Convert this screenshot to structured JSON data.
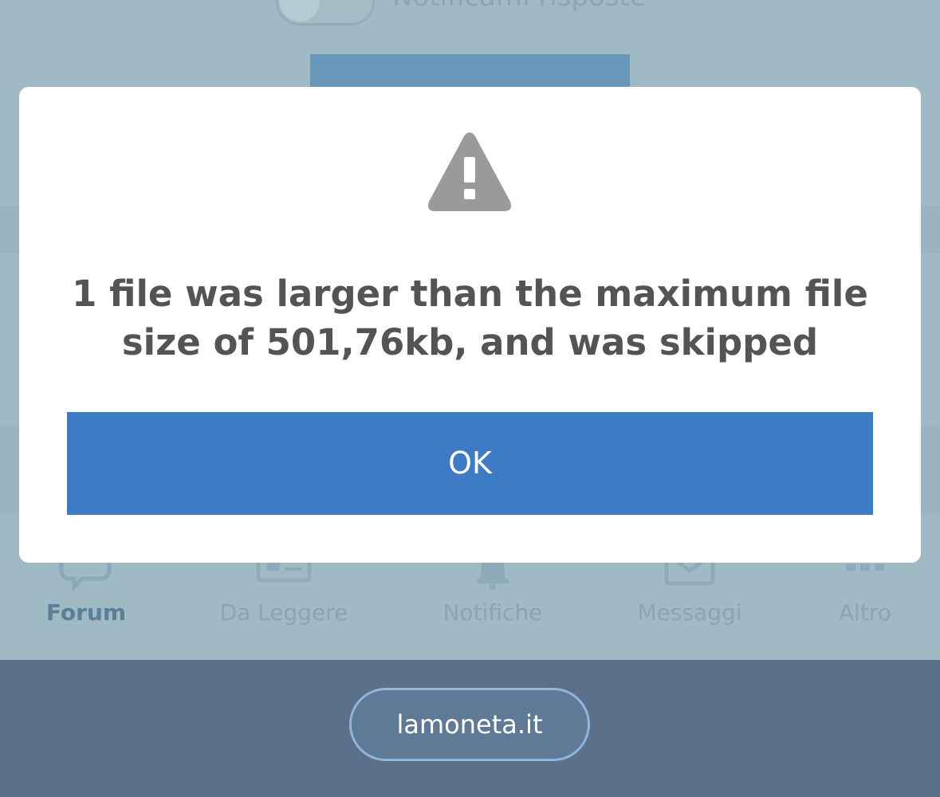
{
  "background_page": {
    "notify_label": "Notificami risposte",
    "tabs": [
      {
        "label": "Forum",
        "icon": "chat-bubbles-icon",
        "active": true
      },
      {
        "label": "Da Leggere",
        "icon": "newspaper-icon",
        "active": false
      },
      {
        "label": "Notifiche",
        "icon": "bell-icon",
        "active": false
      },
      {
        "label": "Messaggi",
        "icon": "envelope-icon",
        "active": false
      },
      {
        "label": "Altro",
        "icon": "more-grid-icon",
        "active": false
      }
    ]
  },
  "modal": {
    "icon": "warning-icon",
    "message": "1 file was larger than the maximum file size of 501,76kb, and was skipped",
    "ok_label": "OK"
  },
  "browser": {
    "url": "lamoneta.it"
  },
  "colors": {
    "accent": "#3d7cc4",
    "overlay_page": "#a0bac5",
    "browser_bar": "#5d7089",
    "message_text": "#545454",
    "warning_icon": "#9a9a9a"
  }
}
